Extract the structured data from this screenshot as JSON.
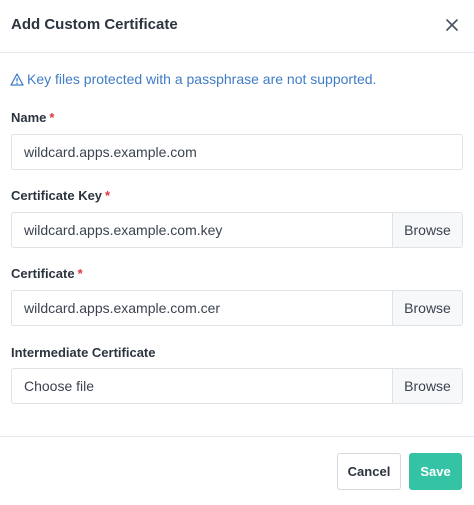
{
  "dialog": {
    "title": "Add Custom Certificate",
    "close_icon": "close-icon"
  },
  "warning": {
    "icon": "warning-triangle-icon",
    "text": "Key files protected with a passphrase are not supported."
  },
  "fields": {
    "name": {
      "label": "Name",
      "required_mark": "*",
      "value": "wildcard.apps.example.com"
    },
    "certificate_key": {
      "label": "Certificate Key",
      "required_mark": "*",
      "value": "wildcard.apps.example.com.key",
      "browse_label": "Browse"
    },
    "certificate": {
      "label": "Certificate",
      "required_mark": "*",
      "value": "wildcard.apps.example.com.cer",
      "browse_label": "Browse"
    },
    "intermediate_certificate": {
      "label": "Intermediate Certificate",
      "value": "Choose file",
      "browse_label": "Browse"
    }
  },
  "footer": {
    "cancel_label": "Cancel",
    "save_label": "Save"
  },
  "colors": {
    "accent": "#35c3a5",
    "info": "#3f7cc6",
    "required": "#d9363e"
  }
}
